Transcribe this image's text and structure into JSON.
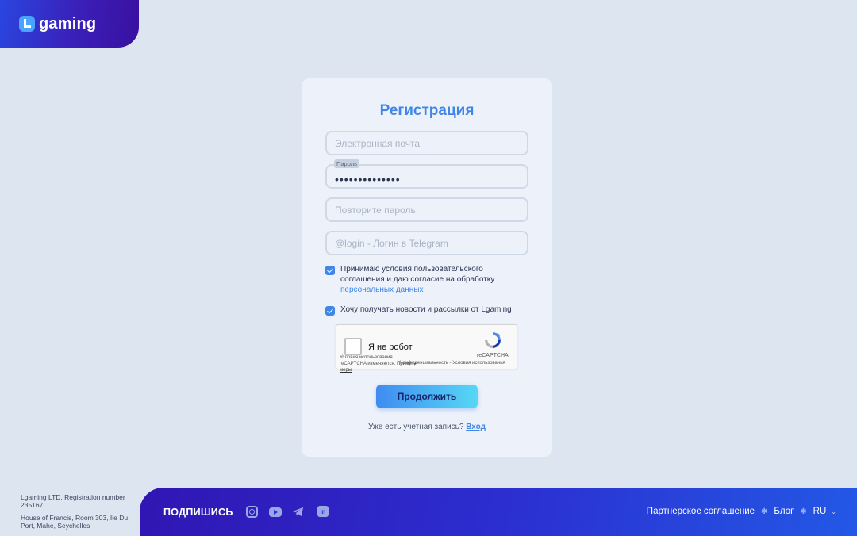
{
  "brand": {
    "name": "gaming"
  },
  "form": {
    "title": "Регистрация",
    "email_placeholder": "Электронная почта",
    "password_label": "Пароль",
    "password_value": "••••••••••••••",
    "repeat_placeholder": "Повторите пароль",
    "telegram_placeholder": "@login - Логин в Telegram",
    "terms_text": "Принимаю условия пользовательского соглашения и даю согласие на обработку",
    "terms_link": "персональных данных",
    "terms_checked": true,
    "newsletter_text": "Хочу получать новости и рассылки от Lgaming",
    "newsletter_checked": true,
    "submit_label": "Продолжить",
    "have_account_text": "Уже есть учетная запись?",
    "login_link": "Вход"
  },
  "captcha": {
    "label": "Я не робот",
    "brand": "reCAPTCHA",
    "fine_print": "Условия использования reCAPTCHA изменяются.",
    "fine_link": "Примите меры",
    "privacy": "Конфиденциальность - Условия использования"
  },
  "footer": {
    "company_line1": "Lgaming LTD, Registration number 235167",
    "company_address": "House of Francis, Room 303, Ile Du Port, Mahe, Seychelles",
    "subscribe_label": "ПОДПИШИСЬ",
    "social_icons": [
      "instagram-icon",
      "youtube-icon",
      "telegram-icon",
      "linkedin-icon"
    ],
    "partner_link": "Партнерское соглашение",
    "blog_link": "Блог",
    "language": "RU"
  },
  "colors": {
    "accent": "#3f86e8",
    "background": "#dde5f1",
    "footer_start": "#3016b3",
    "footer_end": "#2358e6"
  }
}
